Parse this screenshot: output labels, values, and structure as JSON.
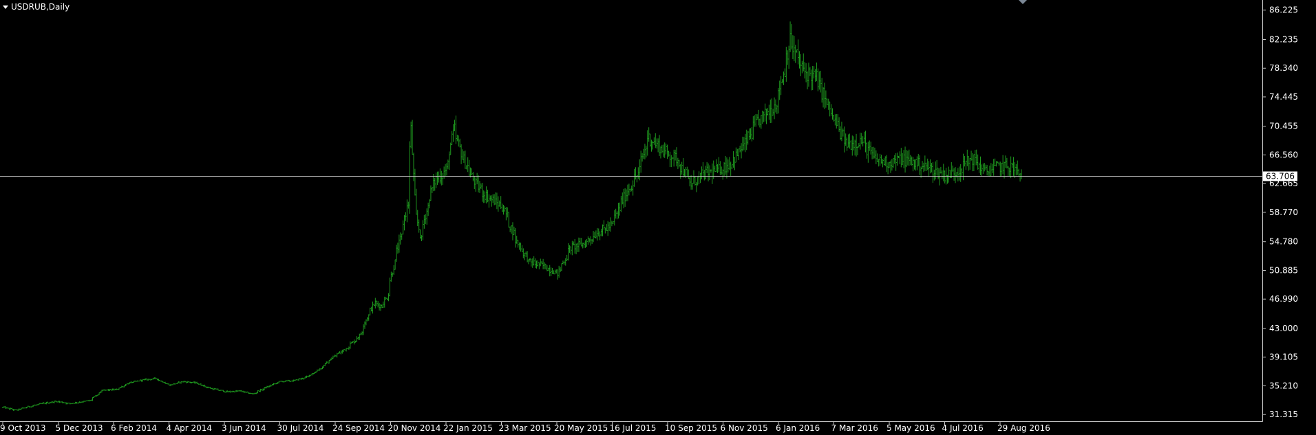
{
  "window": {
    "title": "USDRUB,Daily"
  },
  "colors": {
    "background": "#000000",
    "bars": "#1f9a1f",
    "axis": "#c8c8c8",
    "text": "#ffffff",
    "current_price_line": "#c0c0c0",
    "current_price_label_bg": "#ffffff",
    "current_price_label_text": "#000000",
    "shift_marker": "#7b8795"
  },
  "chart_data": {
    "type": "line",
    "style": "ohlc-bars",
    "title": "USDRUB,Daily",
    "symbol": "USDRUB",
    "timeframe": "Daily",
    "current_price": "63.706",
    "grid": false,
    "ylim": [
      30.4,
      87.6
    ],
    "x_ticks": [
      "9 Oct 2013",
      "5 Dec 2013",
      "6 Feb 2014",
      "4 Apr 2014",
      "3 Jun 2014",
      "30 Jul 2014",
      "24 Sep 2014",
      "20 Nov 2014",
      "22 Jan 2015",
      "23 Mar 2015",
      "20 May 2015",
      "16 Jul 2015",
      "10 Sep 2015",
      "6 Nov 2015",
      "6 Jan 2016",
      "7 Mar 2016",
      "5 May 2016",
      "4 Jul 2016",
      "29 Aug 2016"
    ],
    "y_ticks": [
      "86.225",
      "82.235",
      "78.340",
      "74.445",
      "70.455",
      "66.560",
      "62.665",
      "58.770",
      "54.780",
      "50.885",
      "46.990",
      "43.000",
      "39.105",
      "35.210",
      "31.315"
    ],
    "series": [
      {
        "points": [
          [
            "2013-10-09",
            32.3
          ],
          [
            "2013-10-23",
            31.9
          ],
          [
            "2013-11-06",
            32.4
          ],
          [
            "2013-11-20",
            32.8
          ],
          [
            "2013-12-05",
            33.1
          ],
          [
            "2013-12-19",
            32.8
          ],
          [
            "2014-01-09",
            33.2
          ],
          [
            "2014-01-23",
            34.6
          ],
          [
            "2014-02-06",
            34.7
          ],
          [
            "2014-02-20",
            35.6
          ],
          [
            "2014-03-06",
            36.0
          ],
          [
            "2014-03-20",
            36.2
          ],
          [
            "2014-04-04",
            35.3
          ],
          [
            "2014-04-18",
            35.8
          ],
          [
            "2014-05-02",
            35.6
          ],
          [
            "2014-05-16",
            34.9
          ],
          [
            "2014-06-03",
            34.4
          ],
          [
            "2014-06-17",
            34.5
          ],
          [
            "2014-07-01",
            34.1
          ],
          [
            "2014-07-15",
            35.0
          ],
          [
            "2014-07-30",
            35.8
          ],
          [
            "2014-08-13",
            35.9
          ],
          [
            "2014-08-27",
            36.4
          ],
          [
            "2014-09-10",
            37.5
          ],
          [
            "2014-09-24",
            39.1
          ],
          [
            "2014-10-08",
            40.3
          ],
          [
            "2014-10-22",
            42.0
          ],
          [
            "2014-10-30",
            44.5
          ],
          [
            "2014-11-07",
            46.5
          ],
          [
            "2014-11-14",
            46.0
          ],
          [
            "2014-11-20",
            47.2
          ],
          [
            "2014-11-28",
            52.0
          ],
          [
            "2014-12-05",
            55.5
          ],
          [
            "2014-12-12",
            60.0
          ],
          [
            "2014-12-16",
            70.0
          ],
          [
            "2014-12-19",
            60.5
          ],
          [
            "2014-12-26",
            55.0
          ],
          [
            "2014-12-31",
            58.5
          ],
          [
            "2015-01-09",
            63.0
          ],
          [
            "2015-01-22",
            64.5
          ],
          [
            "2015-01-30",
            70.0
          ],
          [
            "2015-02-06",
            67.0
          ],
          [
            "2015-02-20",
            63.0
          ],
          [
            "2015-03-05",
            61.0
          ],
          [
            "2015-03-23",
            59.5
          ],
          [
            "2015-04-06",
            55.0
          ],
          [
            "2015-04-20",
            52.0
          ],
          [
            "2015-05-05",
            51.5
          ],
          [
            "2015-05-20",
            50.5
          ],
          [
            "2015-06-03",
            54.0
          ],
          [
            "2015-06-17",
            54.5
          ],
          [
            "2015-07-01",
            56.0
          ],
          [
            "2015-07-16",
            57.0
          ],
          [
            "2015-07-30",
            61.0
          ],
          [
            "2015-08-13",
            64.0
          ],
          [
            "2015-08-24",
            69.0
          ],
          [
            "2015-09-10",
            67.0
          ],
          [
            "2015-09-24",
            66.0
          ],
          [
            "2015-10-08",
            62.5
          ],
          [
            "2015-10-22",
            64.0
          ],
          [
            "2015-11-06",
            64.5
          ],
          [
            "2015-11-20",
            65.5
          ],
          [
            "2015-12-04",
            68.0
          ],
          [
            "2015-12-18",
            71.0
          ],
          [
            "2016-01-06",
            73.5
          ],
          [
            "2016-01-14",
            77.5
          ],
          [
            "2016-01-21",
            82.0
          ],
          [
            "2016-02-04",
            78.0
          ],
          [
            "2016-02-18",
            77.0
          ],
          [
            "2016-03-07",
            71.5
          ],
          [
            "2016-03-21",
            68.0
          ],
          [
            "2016-04-06",
            68.5
          ],
          [
            "2016-04-20",
            66.0
          ],
          [
            "2016-05-05",
            65.5
          ],
          [
            "2016-05-19",
            66.0
          ],
          [
            "2016-06-02",
            65.5
          ],
          [
            "2016-06-16",
            64.8
          ],
          [
            "2016-07-04",
            63.8
          ],
          [
            "2016-07-18",
            64.5
          ],
          [
            "2016-08-01",
            66.2
          ],
          [
            "2016-08-15",
            64.2
          ],
          [
            "2016-08-29",
            65.0
          ],
          [
            "2016-09-12",
            65.0
          ],
          [
            "2016-09-22",
            63.7
          ]
        ]
      }
    ]
  }
}
